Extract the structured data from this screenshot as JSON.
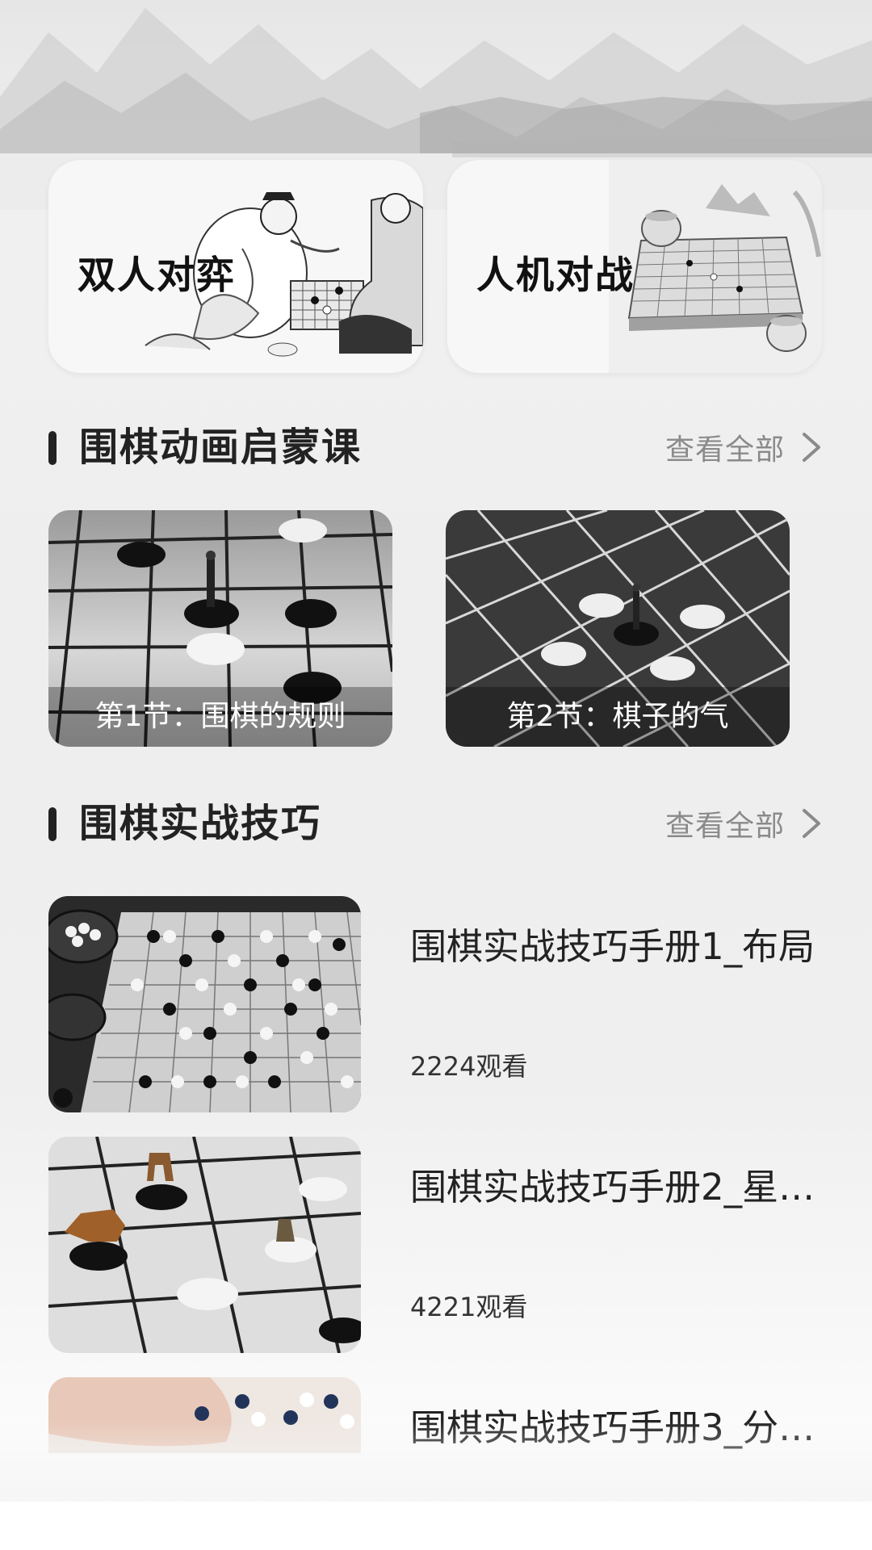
{
  "modes": [
    {
      "label": "双人对弈"
    },
    {
      "label": "人机对战"
    }
  ],
  "animation_section": {
    "title": "围棋动画启蒙课",
    "view_all": "查看全部",
    "lessons": [
      {
        "caption": "第1节：围棋的规则"
      },
      {
        "caption": "第2节：棋子的气"
      }
    ]
  },
  "technique_section": {
    "title": "围棋实战技巧",
    "view_all": "查看全部",
    "items": [
      {
        "title": "围棋实战技巧手册1_布局",
        "views": "2224观看"
      },
      {
        "title": "围棋实战技巧手册2_星…",
        "views": "4221观看"
      },
      {
        "title": "围棋实战技巧手册3_分…",
        "views": ""
      }
    ]
  },
  "colors": {
    "text_primary": "#222222",
    "text_secondary": "#8a8a8a",
    "background": "#f0f0f0"
  }
}
